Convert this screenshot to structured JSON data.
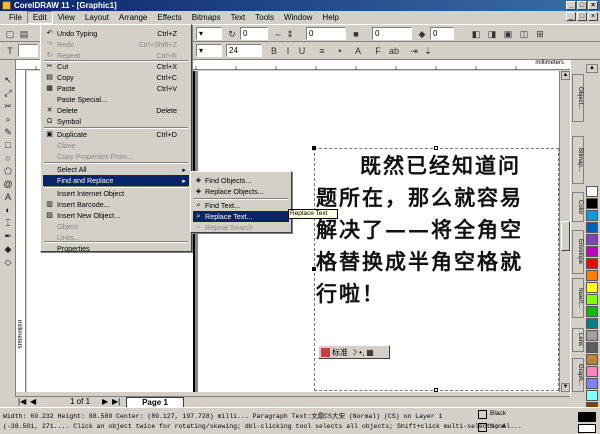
{
  "window": {
    "title": "CorelDRAW 11 - [Graphic1]",
    "controls": [
      "_",
      "□",
      "×"
    ]
  },
  "menubar": {
    "items": [
      "File",
      "Edit",
      "View",
      "Layout",
      "Arrange",
      "Effects",
      "Bitmaps",
      "Text",
      "Tools",
      "Window",
      "Help"
    ],
    "active": "Edit"
  },
  "toolbar": {
    "font_size_value": "24",
    "field1_value": "0",
    "field2_value": "0",
    "field3_value": "0",
    "field4_value": "0"
  },
  "ruler": {
    "unit_label": "millimeters",
    "vertical_unit_label": "millimeters"
  },
  "edit_menu": {
    "items": [
      {
        "label": "Undo Typing",
        "shortcut": "Ctrl+Z",
        "disabled": false
      },
      {
        "label": "Redo",
        "shortcut": "Ctrl+Shift+Z",
        "disabled": true
      },
      {
        "label": "Repeat",
        "shortcut": "Ctrl+R",
        "disabled": true
      },
      {
        "label": "Cut",
        "shortcut": "Ctrl+X",
        "disabled": false
      },
      {
        "label": "Copy",
        "shortcut": "Ctrl+C",
        "disabled": false
      },
      {
        "label": "Paste",
        "shortcut": "Ctrl+V",
        "disabled": false
      },
      {
        "label": "Paste Special...",
        "shortcut": "",
        "disabled": false
      },
      {
        "label": "Delete",
        "shortcut": "Delete",
        "disabled": false
      },
      {
        "label": "Symbol",
        "shortcut": "",
        "disabled": false
      },
      {
        "label": "Duplicate",
        "shortcut": "Ctrl+D",
        "disabled": false
      },
      {
        "label": "Clone",
        "shortcut": "",
        "disabled": true
      },
      {
        "label": "Copy Properties From...",
        "shortcut": "",
        "disabled": true
      },
      {
        "label": "Select All",
        "shortcut": "",
        "disabled": false
      },
      {
        "label": "Find and Replace",
        "shortcut": "",
        "disabled": false
      },
      {
        "label": "Insert Internet Object",
        "shortcut": "",
        "disabled": false
      },
      {
        "label": "Insert Barcode...",
        "shortcut": "",
        "disabled": false
      },
      {
        "label": "Insert New Object...",
        "shortcut": "",
        "disabled": false
      },
      {
        "label": "Object",
        "shortcut": "",
        "disabled": true
      },
      {
        "label": "Links...",
        "shortcut": "",
        "disabled": true
      },
      {
        "label": "Properties",
        "shortcut": "",
        "disabled": false
      }
    ]
  },
  "find_submenu": {
    "items": [
      {
        "label": "Find Objects...",
        "disabled": false
      },
      {
        "label": "Replace Objects...",
        "disabled": false
      },
      {
        "label": "Find Text...",
        "disabled": false
      },
      {
        "label": "Replace Text...",
        "disabled": false
      },
      {
        "label": "Repeat Search",
        "disabled": true
      }
    ]
  },
  "tooltip": "Replace Text",
  "document_text": {
    "line1": "既然已经知道问",
    "line2": "题所在，那么就容易",
    "line3": "解决了——将全角空",
    "line4": "格替换成半角空格就",
    "line5": "行啦！"
  },
  "ime_bar": {
    "label": "标准"
  },
  "page_nav": {
    "counter": "1 of 1",
    "page_tab": "Page 1"
  },
  "dockers": [
    "Object...",
    "Bitmap...",
    "Color",
    "Envelope",
    "Insert...",
    "Lens",
    "Graph..."
  ],
  "palette_colors": [
    "#ffffff",
    "#000000",
    "#00a0e0",
    "#0060c0",
    "#8040c0",
    "#c000c0",
    "#ff0000",
    "#ff8000",
    "#ffff00",
    "#80ff00",
    "#00c000",
    "#008080",
    "#a0a0a0",
    "#606060",
    "#c08040",
    "#ff80c0",
    "#8080ff",
    "#80ffff",
    "#804000",
    "#400080"
  ],
  "status": {
    "line1": "Width: 69.232  Height: 88.589  Center: (89.127, 197.728)  milli...  Paragraph Text:文鼎CS大宋 (Normal) (CS) on Layer 1",
    "line2": "(-38.501, 271.... Click an object twice for rotating/skewing; dbl-clicking tool selects all objects; Shift+click multi-selects; Al...",
    "fill_label": "Black",
    "outline_label": "None"
  }
}
